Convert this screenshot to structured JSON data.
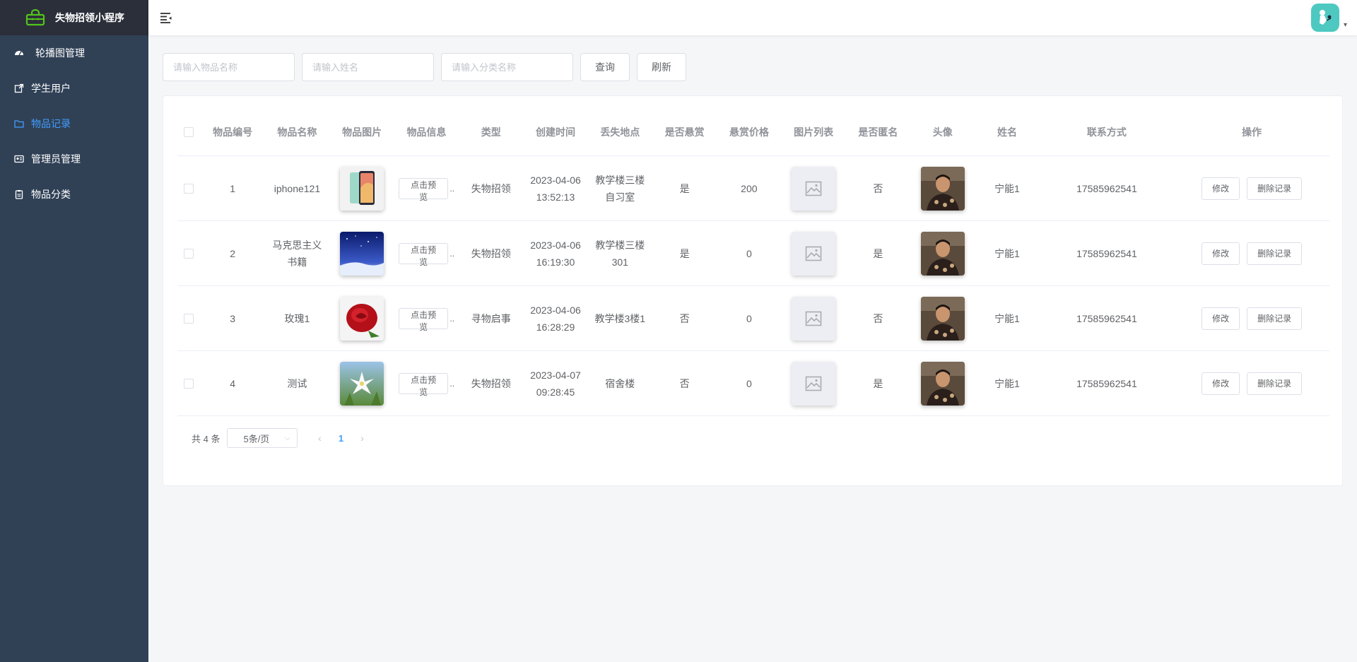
{
  "app": {
    "title": "失物招领小程序",
    "brand_color": "#52c41a"
  },
  "sidebar": {
    "items": [
      {
        "label": "轮播图管理",
        "icon": "dashboard-icon",
        "active": false
      },
      {
        "label": "学生用户",
        "icon": "external-link-icon",
        "active": false
      },
      {
        "label": "物品记录",
        "icon": "folder-icon",
        "active": true
      },
      {
        "label": "管理员管理",
        "icon": "id-card-icon",
        "active": false
      },
      {
        "label": "物品分类",
        "icon": "clipboard-icon",
        "active": false
      }
    ]
  },
  "search": {
    "item_name_placeholder": "请输入物品名称",
    "person_name_placeholder": "请输入姓名",
    "category_placeholder": "请输入分类名称",
    "query_label": "查询",
    "refresh_label": "刷新"
  },
  "table": {
    "headers": [
      "物品编号",
      "物品名称",
      "物品图片",
      "物品信息",
      "类型",
      "创建时间",
      "丢失地点",
      "是否悬赏",
      "悬赏价格",
      "图片列表",
      "是否匿名",
      "头像",
      "姓名",
      "联系方式",
      "操作"
    ],
    "preview_label": "点击预览",
    "edit_label": "修改",
    "delete_label": "删除记录",
    "rows": [
      {
        "id": "1",
        "name": "iphone121",
        "image": "phone",
        "type": "失物招领",
        "time_date": "2023-04-06",
        "time_clock": "13:52:13",
        "location": "教学楼三楼自习室",
        "reward": "是",
        "price": "200",
        "anonymous": "否",
        "person": "宁能1",
        "contact": "17585962541"
      },
      {
        "id": "2",
        "name": "马克思主义书籍",
        "image": "night",
        "type": "失物招领",
        "time_date": "2023-04-06",
        "time_clock": "16:19:30",
        "location": "教学楼三楼301",
        "reward": "是",
        "price": "0",
        "anonymous": "是",
        "person": "宁能1",
        "contact": "17585962541"
      },
      {
        "id": "3",
        "name": "玫瑰1",
        "image": "rose",
        "type": "寻物启事",
        "time_date": "2023-04-06",
        "time_clock": "16:28:29",
        "location": "教学楼3楼1",
        "reward": "否",
        "price": "0",
        "anonymous": "否",
        "person": "宁能1",
        "contact": "17585962541"
      },
      {
        "id": "4",
        "name": "测试",
        "image": "flower",
        "type": "失物招领",
        "time_date": "2023-04-07",
        "time_clock": "09:28:45",
        "location": "宿舍楼",
        "reward": "否",
        "price": "0",
        "anonymous": "是",
        "person": "宁能1",
        "contact": "17585962541"
      }
    ]
  },
  "pagination": {
    "total_text": "共 4 条",
    "page_size": "5条/页",
    "current_page": "1"
  },
  "colors": {
    "sidebar_bg": "#304156",
    "active": "#409eff",
    "avatar_bg": "#4ec9c1"
  }
}
